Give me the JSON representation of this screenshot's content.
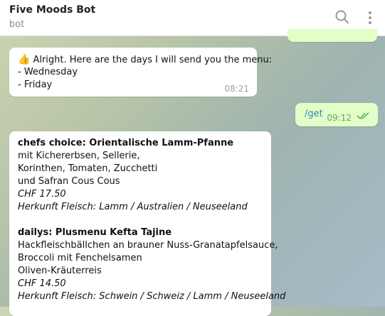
{
  "header": {
    "title": "Five Moods Bot",
    "subtitle": "bot",
    "search_icon": "search-icon",
    "more_icon": "more-vertical-icon"
  },
  "messages": {
    "m1": {
      "emoji": "👍",
      "line1": "Alright. Here are the days I will send you the menu:",
      "line2": "- Wednesday",
      "line3": "- Friday",
      "time": "08:21"
    },
    "m2": {
      "text": "/get",
      "time": "09:12",
      "status_icon": "double-check-icon"
    },
    "m3": {
      "h1": "chefs choice: Orientalische Lamm-Pfanne",
      "l1": "mit Kichererbsen, Sellerie,",
      "l2": "Korinthen, Tomaten, Zucchetti",
      "l3": "und Safran Cous Cous",
      "p1": "CHF 17.50",
      "o1": "Herkunft Fleisch:  Lamm / Australien / Neuseeland",
      "h2": "dailys: Plusmenu Kefta Tajine",
      "l4": "Hackfleischbällchen an brauner Nuss-Granatapfelsauce,",
      "l5": "Broccoli mit Fenchelsamen",
      "l6": "Oliven-Kräuterreis",
      "p2": "CHF 14.50",
      "o2": "Herkunft Fleisch: Schwein / Schweiz / Lamm / Neuseeland"
    }
  }
}
